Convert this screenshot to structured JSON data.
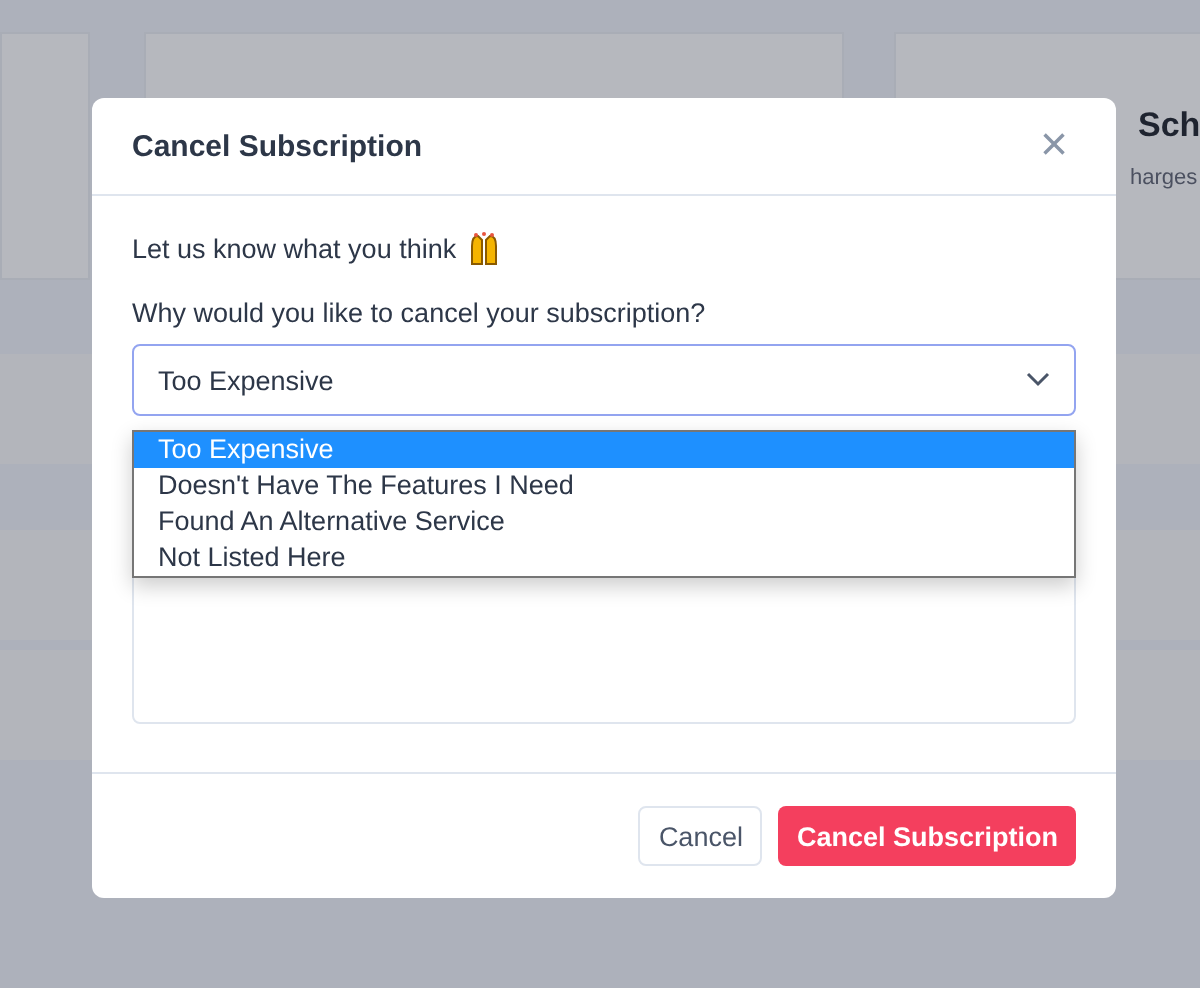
{
  "background": {
    "card_title": "Sch",
    "card_text": "harges"
  },
  "dialog": {
    "title": "Cancel Subscription",
    "close": "×",
    "prompt": "Let us know what you think",
    "question": "Why would you like to cancel your subscription?",
    "select": {
      "value": "Too Expensive",
      "expanded": true,
      "options": [
        {
          "label": "Too Expensive",
          "selected": true
        },
        {
          "label": "Doesn't Have The Features I Need",
          "selected": false
        },
        {
          "label": "Found An Alternative Service",
          "selected": false
        },
        {
          "label": "Not Listed Here",
          "selected": false
        }
      ]
    },
    "buttons": [
      {
        "label": "Cancel",
        "kind": "secondary"
      },
      {
        "label": "Cancel Subscription",
        "kind": "danger"
      }
    ]
  }
}
